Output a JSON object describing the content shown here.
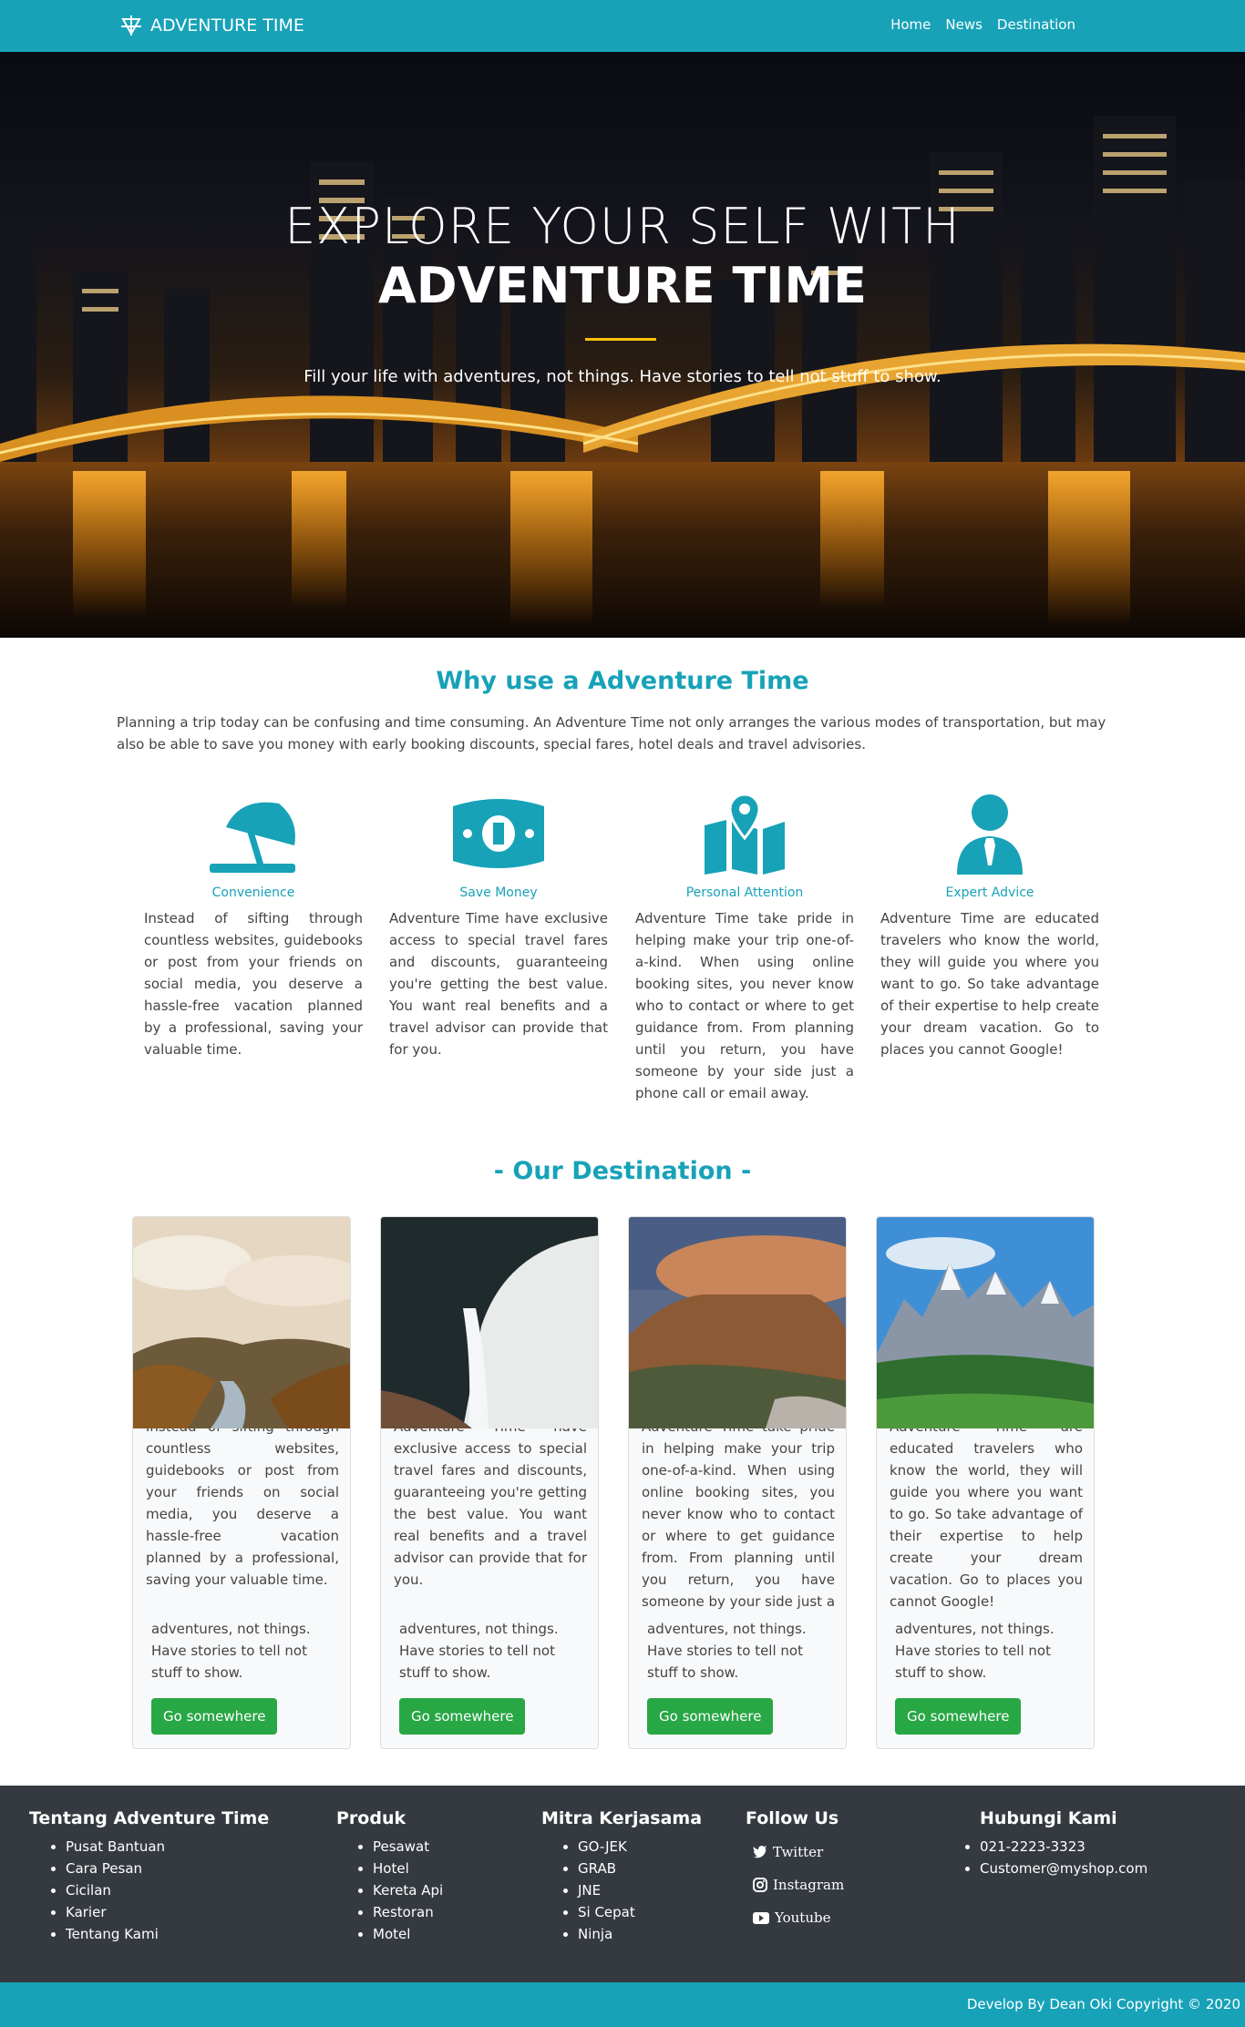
{
  "navbar": {
    "brand": "ADVENTURE TIME",
    "links": [
      "Home",
      "News",
      "Destination"
    ]
  },
  "hero": {
    "title_line1": "EXPLORE YOUR SELF WITH",
    "title_line2": "ADVENTURE TIME",
    "subtitle": "Fill your life with adventures, not things. Have stories to tell not stuff to show."
  },
  "why": {
    "title": "Why use a Adventure Time",
    "text": "Planning a trip today can be confusing and time consuming. An Adventure Time not only arranges the various modes of transportation, but may also be able to save you money with early booking discounts, special fares, hotel deals and travel advisories.",
    "features": [
      {
        "icon": "umbrella-beach-icon",
        "title": "Convenience",
        "desc": "Instead of sifting through countless websites, guidebooks or post from your friends on social media, you deserve a hassle-free vacation planned by a professional, saving your valuable time."
      },
      {
        "icon": "money-bill-icon",
        "title": "Save Money",
        "desc": "Adventure Time have exclusive access to special travel fares and discounts, guaranteeing you're getting the best value. You want real benefits and a travel advisor can provide that for you."
      },
      {
        "icon": "map-marked-icon",
        "title": "Personal Attention",
        "desc": "Adventure Time take pride in helping make your trip one-of-a-kind. When using online booking sites, you never know who to contact or where to get guidance from. From planning until you return, you have someone by your side just a phone call or email away."
      },
      {
        "icon": "user-tie-icon",
        "title": "Expert Advice",
        "desc": "Adventure Time are educated travelers who know the world, they will guide you where you want to go. So take advantage of their expertise to help create your dream vacation. Go to places you cannot Google!"
      }
    ]
  },
  "destination": {
    "title": "- Our Destination -",
    "cards": [
      {
        "text": "Instead of sifting through countless websites, guidebooks or post from your friends on social media, you deserve a hassle-free vacation planned by a professional, saving your valuable time.",
        "snippet": "adventures, not things. Have stories to tell not stuff to show.",
        "button": "Go somewhere"
      },
      {
        "text": "Adventure Time have exclusive access to special travel fares and discounts, guaranteeing you're getting the best value. You want real benefits and a travel advisor can provide that for you.",
        "snippet": "adventures, not things. Have stories to tell not stuff to show.",
        "button": "Go somewhere"
      },
      {
        "text": "Adventure Time take pride in helping make your trip one-of-a-kind. When using online booking sites, you never know who to contact or where to get guidance from. From planning until you return, you have someone by your side just a phone call or email away.",
        "snippet": "adventures, not things. Have stories to tell not stuff to show.",
        "button": "Go somewhere"
      },
      {
        "text": "Adventure Time are educated travelers who know the world, they will guide you where you want to go. So take advantage of their expertise to help create your dream vacation. Go to places you cannot Google!",
        "snippet": "adventures, not things. Have stories to tell not stuff to show.",
        "button": "Go somewhere"
      }
    ]
  },
  "footer": {
    "tentang": {
      "title": "Tentang Adventure Time",
      "items": [
        "Pusat Bantuan",
        "Cara Pesan",
        "Cicilan",
        "Karier",
        "Tentang Kami"
      ]
    },
    "produk": {
      "title": "Produk",
      "items": [
        "Pesawat",
        "Hotel",
        "Kereta Api",
        "Restoran",
        "Motel"
      ]
    },
    "mitra": {
      "title": "Mitra Kerjasama",
      "items": [
        "GO-JEK",
        "GRAB",
        "JNE",
        "Si Cepat",
        "Ninja"
      ]
    },
    "follow": {
      "title": "Follow Us",
      "items": [
        "Twitter",
        "Instagram",
        "Youtube"
      ]
    },
    "hubungi": {
      "title": "Hubungi Kami",
      "items": [
        "021-2223-3323",
        "Customer@myshop.com"
      ]
    },
    "copyright": "Develop By Dean Oki Copyright © 2020"
  },
  "colors": {
    "primary": "#17a2b8",
    "footer": "#343a40",
    "button": "#28a745",
    "accent": "#ffc107"
  }
}
